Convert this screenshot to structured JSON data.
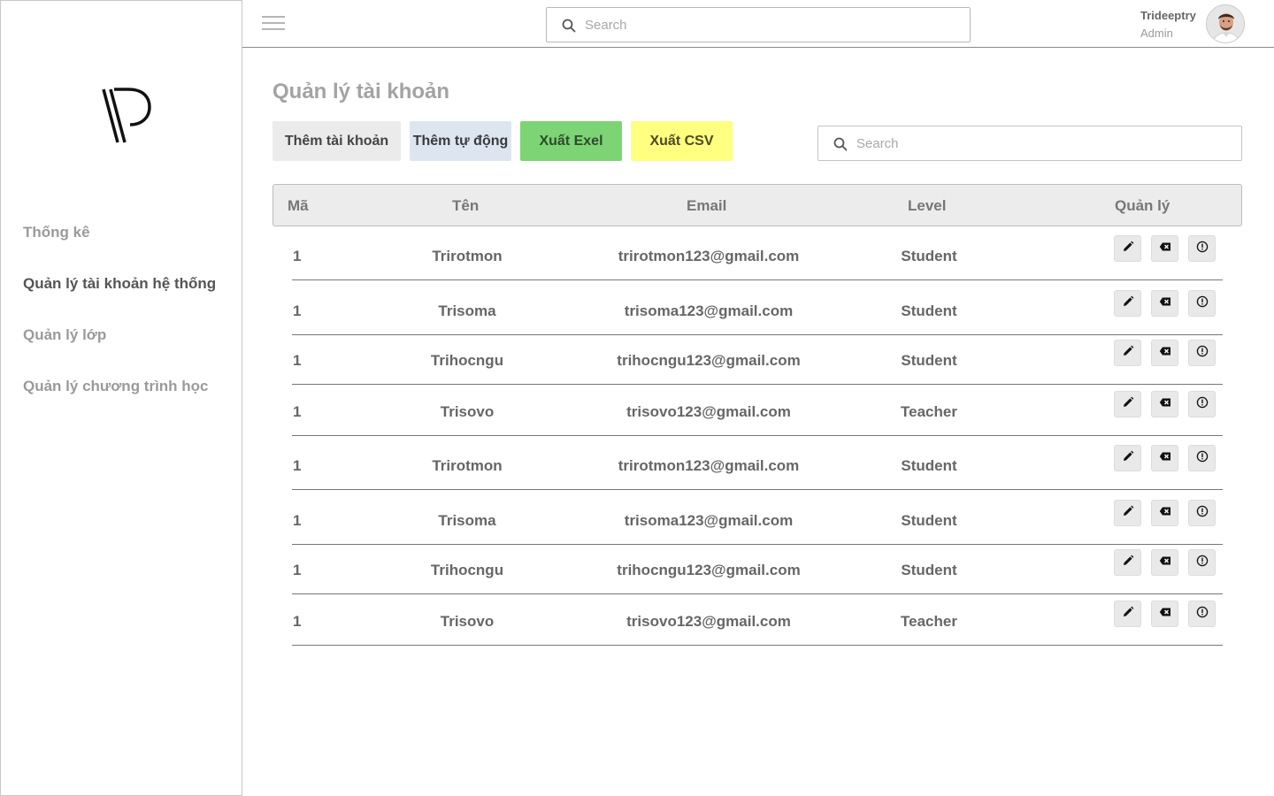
{
  "sidebar": {
    "logo_alt": "logo",
    "items": [
      {
        "label": "Thống kê",
        "active": false
      },
      {
        "label": "Quản lý tài khoản hệ thống",
        "active": true
      },
      {
        "label": "Quản lý lớp",
        "active": false
      },
      {
        "label": "Quản lý chương trình học",
        "active": false
      }
    ]
  },
  "header": {
    "search_placeholder": "Search",
    "user_name": "Trideeptry",
    "user_role": "Admin"
  },
  "main": {
    "title": "Quản lý tài khoản",
    "buttons": {
      "add": "Thêm tài khoản",
      "auto_add": "Thêm tự động",
      "export_excel": "Xuất Exel",
      "export_csv": "Xuất CSV"
    },
    "search_placeholder": "Search",
    "table": {
      "headers": {
        "id": "Mã",
        "name": "Tên",
        "email": "Email",
        "level": "Level",
        "manage": "Quản lý"
      },
      "rows": [
        {
          "id": "1",
          "name": "Trirotmon",
          "email": "trirotmon123@gmail.com",
          "level": "Student"
        },
        {
          "id": "1",
          "name": "Trisoma",
          "email": "trisoma123@gmail.com",
          "level": "Student"
        },
        {
          "id": "1",
          "name": "Trihocngu",
          "email": "trihocngu123@gmail.com",
          "level": "Student"
        },
        {
          "id": "1",
          "name": "Trisovo",
          "email": "trisovo123@gmail.com",
          "level": "Teacher"
        },
        {
          "id": "1",
          "name": "Trirotmon",
          "email": "trirotmon123@gmail.com",
          "level": "Student"
        },
        {
          "id": "1",
          "name": "Trisoma",
          "email": "trisoma123@gmail.com",
          "level": "Student"
        },
        {
          "id": "1",
          "name": "Trihocngu",
          "email": "trihocngu123@gmail.com",
          "level": "Student"
        },
        {
          "id": "1",
          "name": "Trisovo",
          "email": "trisovo123@gmail.com",
          "level": "Teacher"
        }
      ]
    }
  },
  "icons": {
    "menu": "hamburger-menu-icon",
    "search": "search-icon",
    "edit": "pencil-icon",
    "delete": "backspace-delete-icon",
    "info": "info-circle-icon"
  },
  "colors": {
    "excel_button": "#7dd474",
    "csv_button": "#ffff80",
    "auto_button": "#dde6f0",
    "add_button": "#ebebeb"
  }
}
